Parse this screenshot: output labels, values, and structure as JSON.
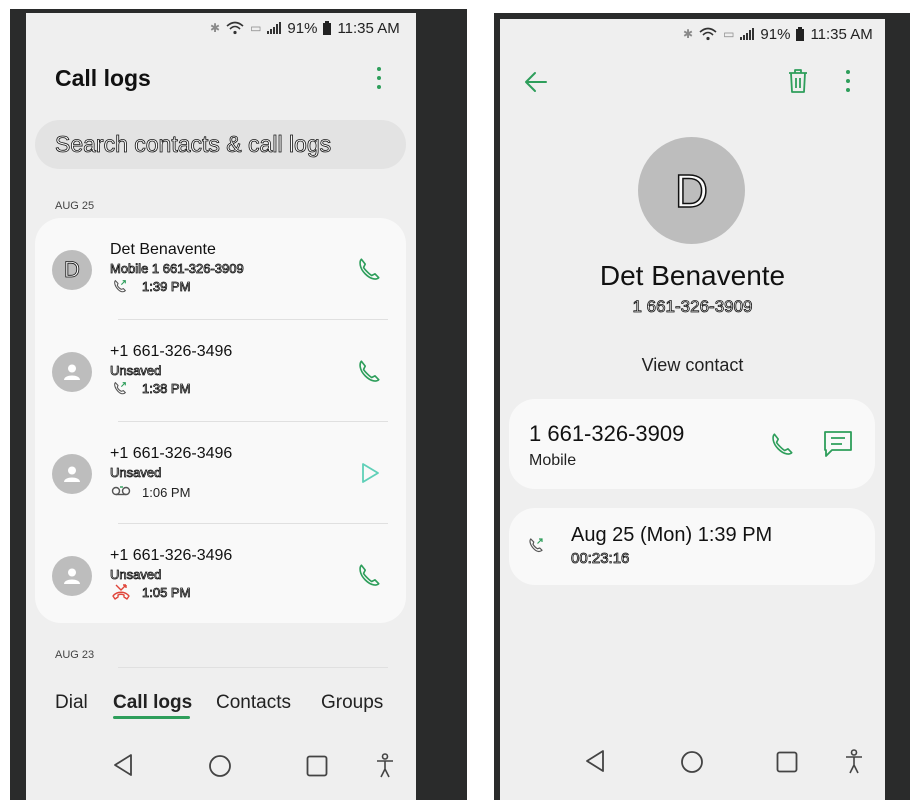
{
  "status": {
    "battery": "91%",
    "time": "11:35 AM"
  },
  "left": {
    "title": "Call logs",
    "search_placeholder": "Search contacts & call logs",
    "date_sections": [
      "AUG 25",
      "AUG 23"
    ],
    "entries": [
      {
        "name": "Det Benavente",
        "avatar": "D",
        "subtitle": "Mobile 1 661-326-3909",
        "time": "1:39 PM",
        "call_type": "outgoing",
        "action": "phone-icon"
      },
      {
        "name": "+1 661-326-3496",
        "avatar": "",
        "subtitle": "Unsaved",
        "time": "1:38 PM",
        "call_type": "outgoing",
        "action": "phone-icon"
      },
      {
        "name": "+1 661-326-3496",
        "avatar": "",
        "subtitle": "Unsaved",
        "time": "1:06 PM",
        "call_type": "voicemail",
        "action": "play-icon"
      },
      {
        "name": "+1 661-326-3496",
        "avatar": "",
        "subtitle": "Unsaved",
        "time": "1:05 PM",
        "call_type": "missed",
        "action": "phone-icon"
      }
    ],
    "tabs": [
      "Dial",
      "Call logs",
      "Contacts",
      "Groups"
    ],
    "active_tab": "Call logs"
  },
  "right": {
    "avatar": "D",
    "name": "Det Benavente",
    "number": "1 661-326-3909",
    "view_contact": "View contact",
    "phone_card": {
      "number": "1 661-326-3909",
      "label": "Mobile"
    },
    "history": {
      "datetime": "Aug 25 (Mon) 1:39 PM",
      "duration": "00:23:16"
    }
  },
  "colors": {
    "accent_green": "#2e9e5b",
    "missed_red": "#e0453a",
    "play_teal": "#5fd0b8",
    "background": "#efefef"
  }
}
